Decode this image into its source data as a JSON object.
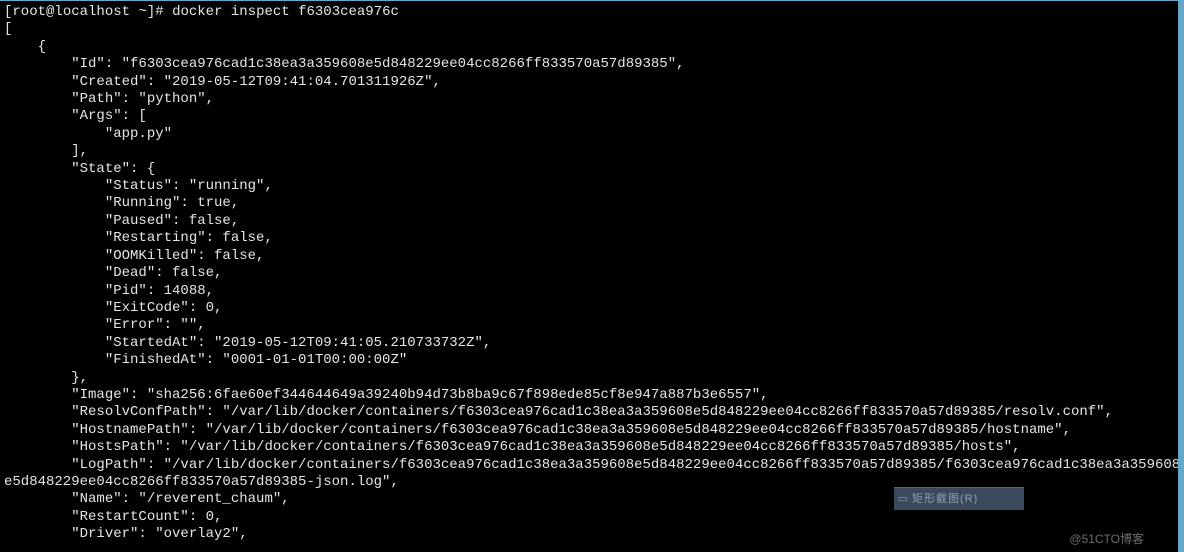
{
  "prompt": {
    "user": "root",
    "host": "localhost",
    "cwd": "~",
    "symbol": "#",
    "command": "docker inspect f6303cea976c"
  },
  "output_lines": [
    "[",
    "    {",
    "        \"Id\": \"f6303cea976cad1c38ea3a359608e5d848229ee04cc8266ff833570a57d89385\",",
    "        \"Created\": \"2019-05-12T09:41:04.701311926Z\",",
    "        \"Path\": \"python\",",
    "        \"Args\": [",
    "            \"app.py\"",
    "        ],",
    "        \"State\": {",
    "            \"Status\": \"running\",",
    "            \"Running\": true,",
    "            \"Paused\": false,",
    "            \"Restarting\": false,",
    "            \"OOMKilled\": false,",
    "            \"Dead\": false,",
    "            \"Pid\": 14088,",
    "            \"ExitCode\": 0,",
    "            \"Error\": \"\",",
    "            \"StartedAt\": \"2019-05-12T09:41:05.210733732Z\",",
    "            \"FinishedAt\": \"0001-01-01T00:00:00Z\"",
    "        },",
    "        \"Image\": \"sha256:6fae60ef344644649a39240b94d73b8ba9c67f898ede85cf8e947a887b3e6557\",",
    "        \"ResolvConfPath\": \"/var/lib/docker/containers/f6303cea976cad1c38ea3a359608e5d848229ee04cc8266ff833570a57d89385/resolv.conf\",",
    "        \"HostnamePath\": \"/var/lib/docker/containers/f6303cea976cad1c38ea3a359608e5d848229ee04cc8266ff833570a57d89385/hostname\",",
    "        \"HostsPath\": \"/var/lib/docker/containers/f6303cea976cad1c38ea3a359608e5d848229ee04cc8266ff833570a57d89385/hosts\",",
    "        \"LogPath\": \"/var/lib/docker/containers/f6303cea976cad1c38ea3a359608e5d848229ee04cc8266ff833570a57d89385/f6303cea976cad1c38ea3a359608",
    "e5d848229ee04cc8266ff833570a57d89385-json.log\",",
    "        \"Name\": \"/reverent_chaum\",",
    "        \"RestartCount\": 0,",
    "        \"Driver\": \"overlay2\","
  ],
  "floating_tab": {
    "label": "矩形截图(R)"
  },
  "watermark": "@51CTO博客"
}
